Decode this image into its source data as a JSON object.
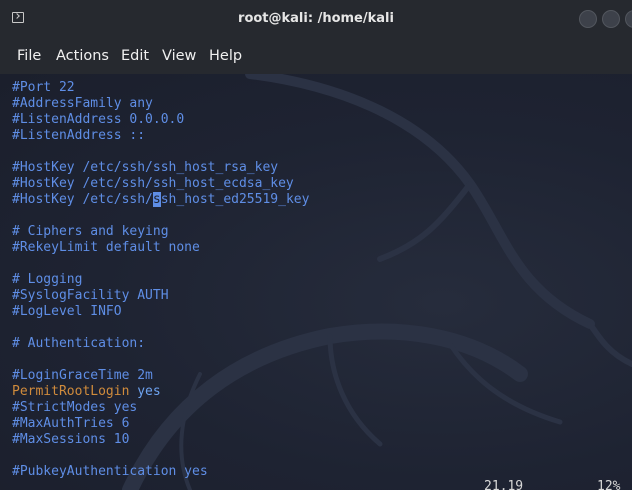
{
  "window": {
    "title": "root@kali: /home/kali"
  },
  "menu": {
    "items": [
      "File",
      "Actions",
      "Edit",
      "View",
      "Help"
    ]
  },
  "editor": {
    "lines": [
      "#Port 22",
      "#AddressFamily any",
      "#ListenAddress 0.0.0.0",
      "#ListenAddress ::",
      "",
      "#HostKey /etc/ssh/ssh_host_rsa_key",
      "#HostKey /etc/ssh/ssh_host_ecdsa_key",
      "#HostKey /etc/ssh/",
      "",
      "# Ciphers and keying",
      "#RekeyLimit default none",
      "",
      "# Logging",
      "#SyslogFacility AUTH",
      "#LogLevel INFO",
      "",
      "# Authentication:",
      "",
      "#LoginGraceTime 2m",
      "PermitRootLogin",
      "#StrictModes yes",
      "#MaxAuthTries 6",
      "#MaxSessions 10",
      "",
      "#PubkeyAuthentication yes"
    ],
    "cursor_char": "s",
    "cursor_rest": "sh_host_ed25519_key",
    "permit_value": " yes"
  },
  "status": {
    "position": "21,19",
    "percent": "12%"
  },
  "colors": {
    "comment": "#5f8ee6",
    "keyword": "#d08b3c",
    "background": "#1d2230"
  }
}
